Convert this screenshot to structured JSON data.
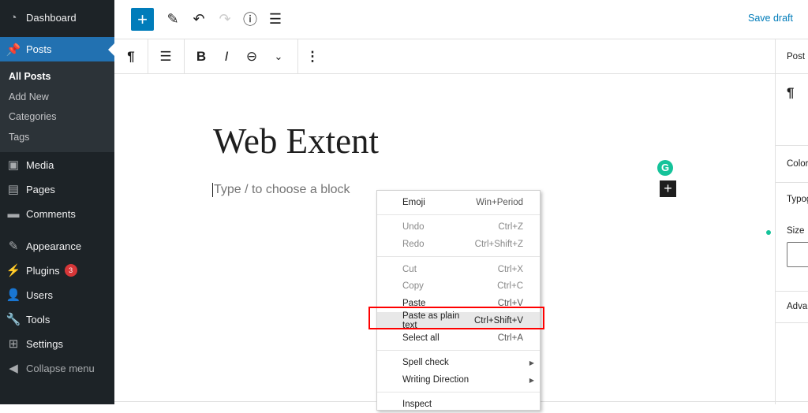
{
  "sidebar": {
    "items": [
      {
        "label": "Dashboard",
        "icon": "dashboard-icon"
      },
      {
        "label": "Posts",
        "icon": "pin-icon"
      },
      {
        "label": "Media",
        "icon": "media-icon"
      },
      {
        "label": "Pages",
        "icon": "pages-icon"
      },
      {
        "label": "Comments",
        "icon": "comment-icon"
      },
      {
        "label": "Appearance",
        "icon": "brush-icon"
      },
      {
        "label": "Plugins",
        "icon": "plugin-icon",
        "badge": "3"
      },
      {
        "label": "Users",
        "icon": "user-icon"
      },
      {
        "label": "Tools",
        "icon": "wrench-icon"
      },
      {
        "label": "Settings",
        "icon": "settings-icon"
      },
      {
        "label": "Collapse menu",
        "icon": "collapse-icon"
      }
    ],
    "submenu": [
      "All Posts",
      "Add New",
      "Categories",
      "Tags"
    ]
  },
  "topbar": {
    "save_label": "Save draft",
    "accent": "#007cba"
  },
  "editor": {
    "title": "Web Extent",
    "placeholder": "Type / to choose a block"
  },
  "right_sidebar": {
    "tab": "Post",
    "color": "Color",
    "typography": "Typography",
    "size": "Size",
    "advanced": "Advanced"
  },
  "context_menu": {
    "items": [
      {
        "label": "Emoji",
        "shortcut": "Win+Period"
      },
      {
        "label": "Undo",
        "shortcut": "Ctrl+Z"
      },
      {
        "label": "Redo",
        "shortcut": "Ctrl+Shift+Z"
      },
      {
        "label": "Cut",
        "shortcut": "Ctrl+X"
      },
      {
        "label": "Copy",
        "shortcut": "Ctrl+C"
      },
      {
        "label": "Paste",
        "shortcut": "Ctrl+V"
      },
      {
        "label": "Paste as plain text",
        "shortcut": "Ctrl+Shift+V"
      },
      {
        "label": "Select all",
        "shortcut": "Ctrl+A"
      },
      {
        "label": "Spell check"
      },
      {
        "label": "Writing Direction"
      },
      {
        "label": "Inspect"
      }
    ]
  }
}
